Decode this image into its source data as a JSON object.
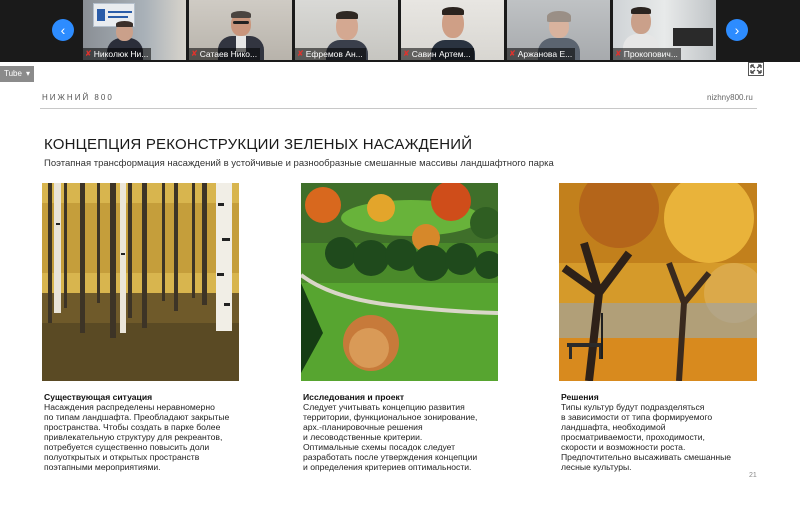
{
  "meeting": {
    "participants": [
      {
        "name": "Николюк Ни..."
      },
      {
        "name": "Сатаев Нико..."
      },
      {
        "name": "Ефремов Ан..."
      },
      {
        "name": "Савин Артем..."
      },
      {
        "name": "Аржанова Е..."
      },
      {
        "name": "Прокопович..."
      }
    ],
    "nav_prev": "‹",
    "nav_next": "›"
  },
  "screen": {
    "yt_tab_label": "Tube",
    "yt_tab_caret": "▾"
  },
  "slide": {
    "brand": "НИЖНИЙ 800",
    "url": "nizhny800.ru",
    "title": "КОНЦЕПЦИЯ РЕКОНСТРУКЦИИ ЗЕЛЕНЫХ НАСАЖДЕНИЙ",
    "subtitle": "Поэтапная трансформация насаждений в устойчивые и разнообразные смешанные массивы ландшафтного парка",
    "columns": [
      {
        "heading": "Существующая ситуация",
        "lines": [
          "Насаждения распределены неравномерно",
          "по типам ландшафта. Преобладают закрытые",
          "пространства. Чтобы создать в парке более",
          "привлекательную структуру для рекреантов,",
          "потребуется существенно повысить доли",
          "полуоткрытых и открытых пространств",
          "поэтапными мероприятиями."
        ]
      },
      {
        "heading": "Исследования и проект",
        "lines": [
          "Следует учитывать концепцию развития",
          "территории, функциональное зонирование,",
          "арх.-планировочные решения",
          "и лесоводственные критерии.",
          "Оптимальные схемы посадок следует",
          "разработать после утверждения концепции",
          "и определения критериев оптимальности."
        ]
      },
      {
        "heading": "Решения",
        "lines": [
          "Типы культур будут подразделяться",
          "в зависимости от типа формируемого",
          "ландшафта, необходимой",
          "просматриваемости, проходимости,",
          "скорости и возможности роста.",
          "Предпочтительно высаживать смешанные",
          "лесные культуры."
        ]
      }
    ],
    "page_number": "21"
  }
}
